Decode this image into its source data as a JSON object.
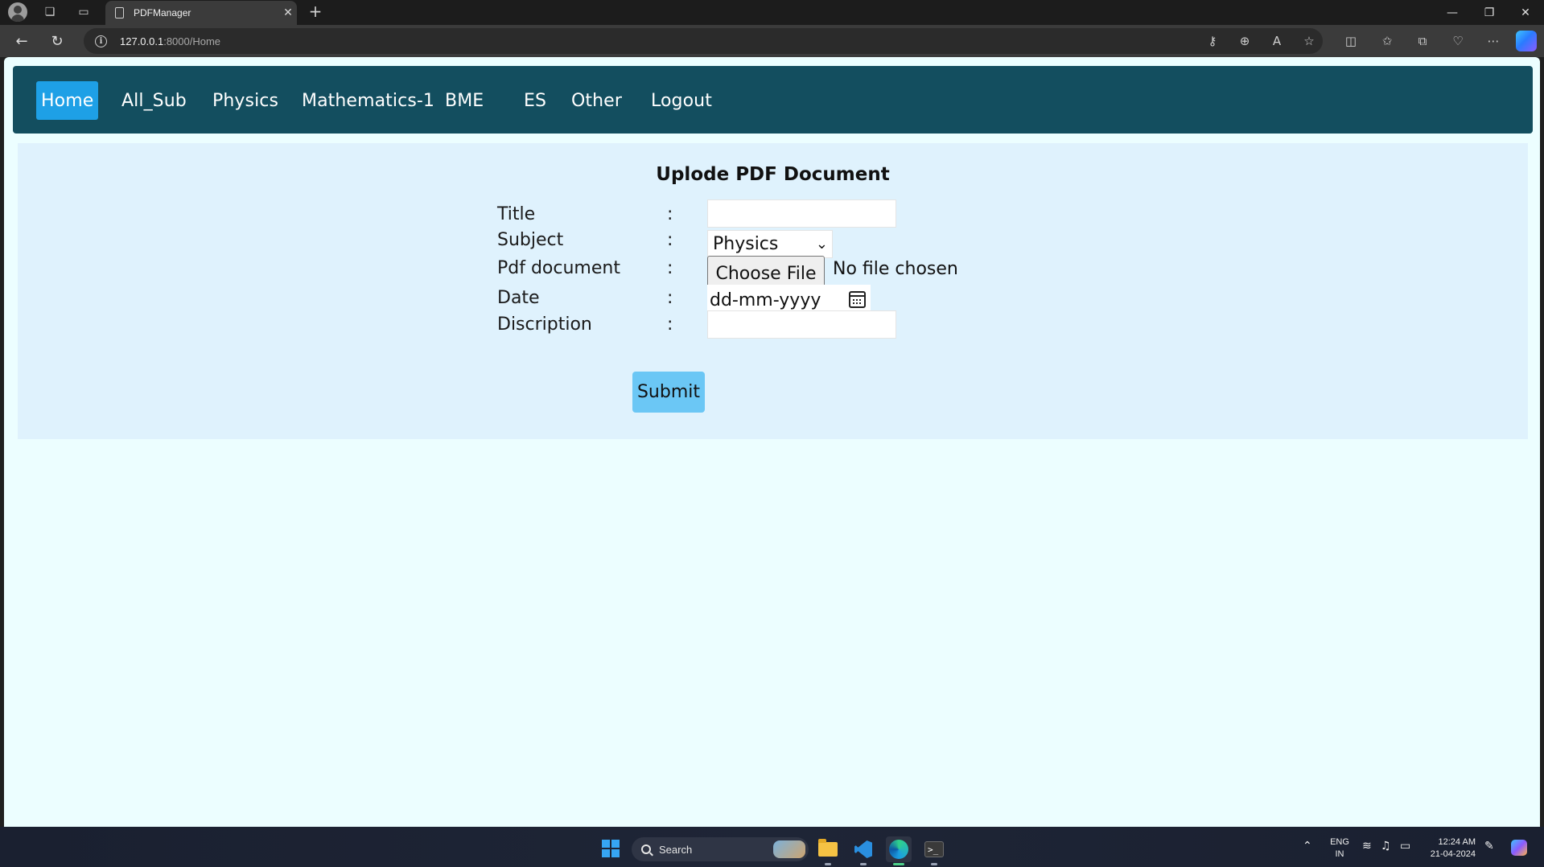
{
  "browser": {
    "tab_title": "PDFManager",
    "tab_close_glyph": "✕",
    "new_tab_glyph": "+",
    "url_host": "127.0.0.1",
    "url_path": ":8000/Home",
    "minimize_glyph": "—",
    "restore_glyph": "❐",
    "close_glyph": "✕"
  },
  "navbar": {
    "items": [
      {
        "label": "Home",
        "active": true
      },
      {
        "label": "All_Sub"
      },
      {
        "label": "Physics"
      },
      {
        "label": "Mathematics-1"
      },
      {
        "label": "BME"
      },
      {
        "label": "ES"
      },
      {
        "label": "Other"
      },
      {
        "label": "Logout"
      }
    ]
  },
  "form": {
    "title": "Uplode PDF Document",
    "separator": ":",
    "title_label": "Title",
    "title_value": "",
    "subject_label": "Subject",
    "subject_value": "Physics",
    "pdf_label": "Pdf document",
    "choose_file_label": "Choose File",
    "file_status": "No file chosen",
    "date_label": "Date",
    "date_placeholder": "dd-mm-yyyy",
    "description_label": "Discription",
    "description_value": "",
    "submit_label": "Submit"
  },
  "taskbar": {
    "search_label": "Search",
    "lang_line1": "ENG",
    "lang_line2": "IN",
    "time": "12:24 AM",
    "date": "21-04-2024"
  },
  "colors": {
    "navbar_bg": "#134e5f",
    "active_nav": "#1ea0e6",
    "page_bg": "#ecfeff",
    "panel_bg": "#dff2fd",
    "submit_bg": "#6bc7f5"
  },
  "icons": [
    "profile-avatar-icon",
    "workspaces-icon",
    "tab-actions-icon",
    "document-icon",
    "back-arrow-icon",
    "refresh-icon",
    "info-icon",
    "key-icon",
    "zoom-icon",
    "read-aloud-icon",
    "favorite-star-icon",
    "split-screen-icon",
    "favorites-icon",
    "collections-icon",
    "health-icon",
    "more-icon",
    "copilot-icon",
    "chevron-down-icon",
    "calendar-icon",
    "windows-start-icon",
    "search-icon",
    "file-explorer-icon",
    "vscode-icon",
    "edge-icon",
    "terminal-icon",
    "chevron-up-icon",
    "wifi-icon",
    "volume-icon",
    "battery-icon",
    "notification-icon"
  ]
}
